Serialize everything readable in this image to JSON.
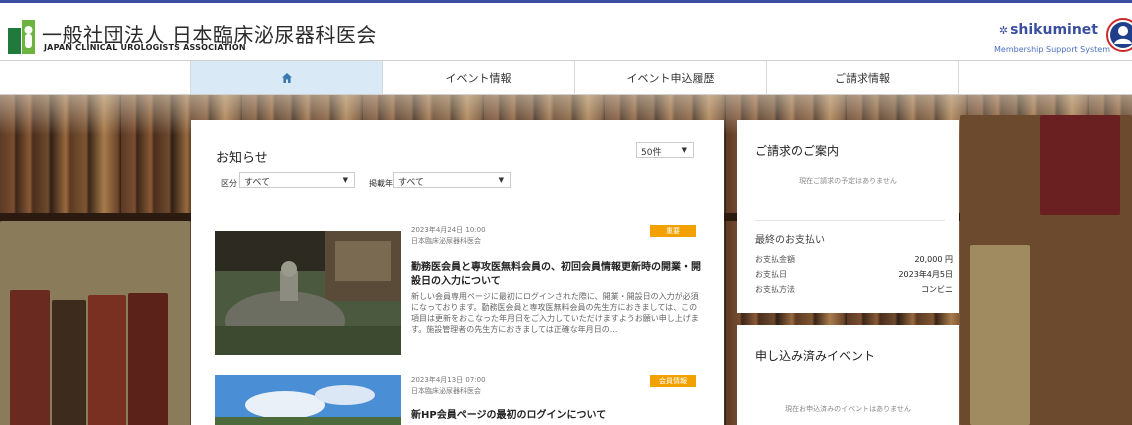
{
  "header": {
    "org_title": "一般社団法人 日本臨床泌尿器科医会",
    "org_subtitle": "JAPAN CLINICAL UROLOGISTS ASSOCIATION",
    "brand_name": "shikuminet",
    "brand_subtitle": "Membership Support System"
  },
  "nav": {
    "items": [
      {
        "label": "",
        "icon": "home-icon",
        "active": true
      },
      {
        "label": "イベント情報"
      },
      {
        "label": "イベント申込履歴"
      },
      {
        "label": "ご請求情報"
      }
    ]
  },
  "news": {
    "title": "お知らせ",
    "per_page": "50件",
    "filter_category_label": "区分",
    "filter_category_value": "すべて",
    "filter_year_label": "掲載年",
    "filter_year_value": "すべて",
    "items": [
      {
        "date": "2023年4月24日 10:00",
        "publisher": "日本臨床泌尿器科医会",
        "tag": "重要",
        "tag_color": "#f2a100",
        "title": "勤務医会員と専攻医無料会員の、初回会員情報更新時の開業・開設日の入力について",
        "body": "新しい会員専用ページに最初にログインされた際に、開業・開設日の入力が必須になっております。勤務医会員と専攻医無料会員の先生方におきましては、この項目は更新をおこなった年月日をご入力していただけますようお願い申し上げます。施設管理者の先生方におきましては正確な年月日の..."
      },
      {
        "date": "2023年4月13日 07:00",
        "publisher": "日本臨床泌尿器科医会",
        "tag": "会員情報",
        "tag_color": "#f2a100",
        "title": "新HP会員ページの最初のログインについて",
        "body": ""
      }
    ]
  },
  "invoice": {
    "title": "ご請求のご案内",
    "empty_note": "現在ご請求の予定はありません",
    "last_payment_title": "最終のお支払い",
    "rows": [
      {
        "label": "お支払金額",
        "value": "20,000 円"
      },
      {
        "label": "お支払日",
        "value": "2023年4月5日"
      },
      {
        "label": "お支払方法",
        "value": "コンビニ"
      }
    ]
  },
  "events": {
    "title": "申し込み済みイベント",
    "empty_note": "現在お申込済みのイベントはありません"
  }
}
